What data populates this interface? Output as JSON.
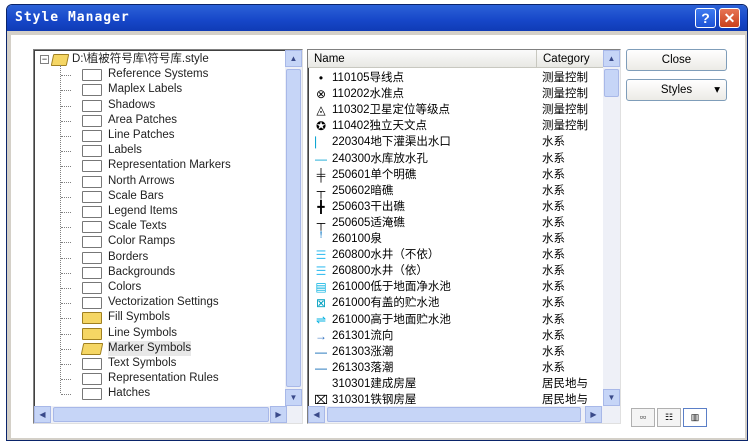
{
  "window": {
    "title": "Style Manager",
    "help_label": "?",
    "close_label": "✕"
  },
  "tree": {
    "root": "D:\\植被符号库\\符号库.style",
    "expander": "−",
    "items": [
      {
        "label": "Reference Systems",
        "icon": "folder-icon"
      },
      {
        "label": "Maplex Labels",
        "icon": "folder-icon"
      },
      {
        "label": "Shadows",
        "icon": "folder-icon"
      },
      {
        "label": "Area Patches",
        "icon": "folder-icon"
      },
      {
        "label": "Line Patches",
        "icon": "folder-icon"
      },
      {
        "label": "Labels",
        "icon": "folder-icon"
      },
      {
        "label": "Representation Markers",
        "icon": "folder-icon"
      },
      {
        "label": "North Arrows",
        "icon": "folder-icon"
      },
      {
        "label": "Scale Bars",
        "icon": "folder-icon"
      },
      {
        "label": "Legend Items",
        "icon": "folder-icon"
      },
      {
        "label": "Scale Texts",
        "icon": "folder-icon"
      },
      {
        "label": "Color Ramps",
        "icon": "folder-icon"
      },
      {
        "label": "Borders",
        "icon": "folder-icon"
      },
      {
        "label": "Backgrounds",
        "icon": "folder-icon"
      },
      {
        "label": "Colors",
        "icon": "folder-icon"
      },
      {
        "label": "Vectorization Settings",
        "icon": "folder-icon"
      },
      {
        "label": "Fill Symbols",
        "icon": "folder-yellow-icon"
      },
      {
        "label": "Line Symbols",
        "icon": "folder-yellow-icon"
      },
      {
        "label": "Marker Symbols",
        "icon": "folder-open-icon",
        "selected": true
      },
      {
        "label": "Text Symbols",
        "icon": "folder-icon"
      },
      {
        "label": "Representation Rules",
        "icon": "folder-icon"
      },
      {
        "label": "Hatches",
        "icon": "folder-icon"
      }
    ]
  },
  "list": {
    "columns": {
      "name": "Name",
      "category": "Category"
    },
    "rows": [
      {
        "symbol": "•",
        "sym_color": "#000000",
        "name": "110105导线点",
        "category": "测量控制"
      },
      {
        "symbol": "⊗",
        "sym_color": "#000000",
        "name": "110202水准点",
        "category": "测量控制"
      },
      {
        "symbol": "◬",
        "sym_color": "#000000",
        "name": "110302卫星定位等级点",
        "category": "测量控制"
      },
      {
        "symbol": "✪",
        "sym_color": "#000000",
        "name": "110402独立天文点",
        "category": "测量控制"
      },
      {
        "symbol": "⎸",
        "sym_color": "#00a0d0",
        "name": "220304地下灌渠出水口",
        "category": "水系"
      },
      {
        "symbol": "—",
        "sym_color": "#00a0d0",
        "name": "240300水库放水孔",
        "category": "水系"
      },
      {
        "symbol": "╪",
        "sym_color": "#000000",
        "name": "250601单个明礁",
        "category": "水系"
      },
      {
        "symbol": "┬",
        "sym_color": "#000000",
        "name": "250602暗礁",
        "category": "水系"
      },
      {
        "symbol": "╋",
        "sym_color": "#000000",
        "name": "250603干出礁",
        "category": "水系"
      },
      {
        "symbol": "┬",
        "sym_color": "#000000",
        "name": "250605适淹礁",
        "category": "水系"
      },
      {
        "symbol": "ꜝ",
        "sym_color": "#0070c0",
        "name": "260100泉",
        "category": "水系"
      },
      {
        "symbol": "☰",
        "sym_color": "#40c0f0",
        "name": "260800水井（不依）",
        "category": "水系"
      },
      {
        "symbol": "☰",
        "sym_color": "#40c0f0",
        "name": "260800水井（依）",
        "category": "水系"
      },
      {
        "symbol": "▤",
        "sym_color": "#00b0e0",
        "name": "261000低于地面净水池",
        "category": "水系"
      },
      {
        "symbol": "⊠",
        "sym_color": "#00a0c0",
        "name": "261000有盖的贮水池",
        "category": "水系"
      },
      {
        "symbol": "⇌",
        "sym_color": "#00b0e0",
        "name": "261000高于地面贮水池",
        "category": "水系"
      },
      {
        "symbol": "→",
        "sym_color": "#3070c0",
        "name": "261301流向",
        "category": "水系"
      },
      {
        "symbol": "—",
        "sym_color": "#0060b0",
        "name": "261303涨潮",
        "category": "水系"
      },
      {
        "symbol": "—",
        "sym_color": "#0060b0",
        "name": "261303落潮",
        "category": "水系"
      },
      {
        "symbol": "",
        "sym_color": "#000000",
        "name": "310301建成房屋",
        "category": "居民地与"
      },
      {
        "symbol": "⌧",
        "sym_color": "#000000",
        "name": "310301铁钢房屋",
        "category": "居民地与"
      }
    ]
  },
  "buttons": {
    "close": "Close",
    "styles": "Styles",
    "styles_arrow": "▾"
  },
  "view_buttons": [
    {
      "name": "large-icons-view-button",
      "glyph": "▫▫"
    },
    {
      "name": "list-view-button",
      "glyph": "☷"
    },
    {
      "name": "details-view-button",
      "glyph": "▥",
      "active": true
    }
  ],
  "scroll": {
    "up": "▲",
    "down": "▼",
    "left": "◀",
    "right": "▶"
  }
}
